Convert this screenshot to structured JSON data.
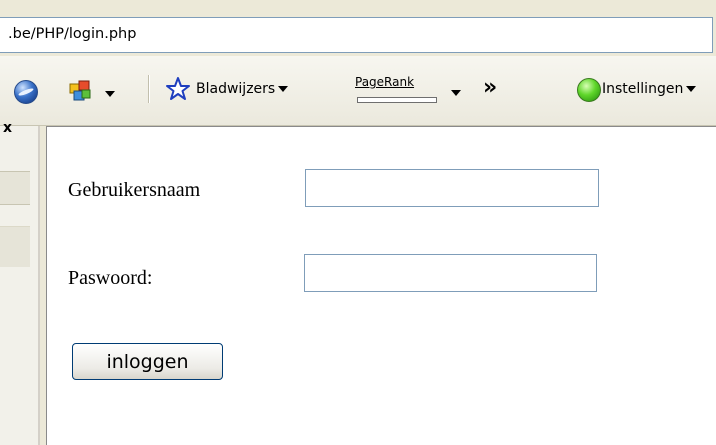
{
  "address_bar": {
    "url": ".be/PHP/login.php"
  },
  "toolbar": {
    "google_icon": "google-search-icon",
    "extension_icon": "puzzle-icon",
    "bookmarks_label": "Bladwijzers",
    "pagerank_label": "PageRank",
    "overflow": "»",
    "settings_label": "Instellingen",
    "settings_icon": "green-status-icon"
  },
  "sidebar": {
    "close_glyph": "x"
  },
  "form": {
    "username_label": "Gebruikersnaam",
    "username_value": "",
    "password_label": "Paswoord:",
    "password_value": "",
    "submit_label": "inloggen"
  }
}
